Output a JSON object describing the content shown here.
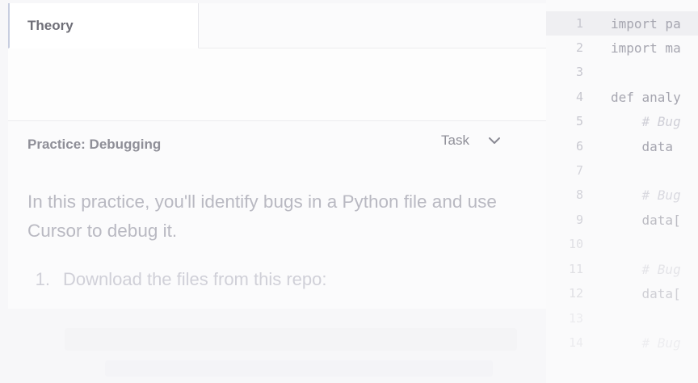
{
  "left_panel": {
    "tabs": [
      {
        "label": "Theory",
        "active": true
      }
    ],
    "practice": {
      "title": "Practice: Debugging",
      "toggle_label": "Task",
      "intro": "In this practice, you'll identify bugs in a Python file and use Cursor to debug it.",
      "steps": [
        {
          "number": "1.",
          "text": "Download the files from this repo:"
        }
      ]
    }
  },
  "code_editor": {
    "lines": [
      {
        "number": "1",
        "code": "import pa"
      },
      {
        "number": "2",
        "code": "import ma"
      },
      {
        "number": "3",
        "code": ""
      },
      {
        "number": "4",
        "code": "def analy"
      },
      {
        "number": "5",
        "code": "    # Bug"
      },
      {
        "number": "6",
        "code": "    data "
      },
      {
        "number": "7",
        "code": ""
      },
      {
        "number": "8",
        "code": "    # Bug"
      },
      {
        "number": "9",
        "code": "    data["
      },
      {
        "number": "10",
        "code": ""
      },
      {
        "number": "11",
        "code": "    # Bug"
      },
      {
        "number": "12",
        "code": "    data["
      },
      {
        "number": "13",
        "code": ""
      },
      {
        "number": "14",
        "code": "    # Bug"
      }
    ]
  },
  "colors": {
    "accent_tab_border": "#c8cee0",
    "text_muted": "#8f8f98"
  }
}
